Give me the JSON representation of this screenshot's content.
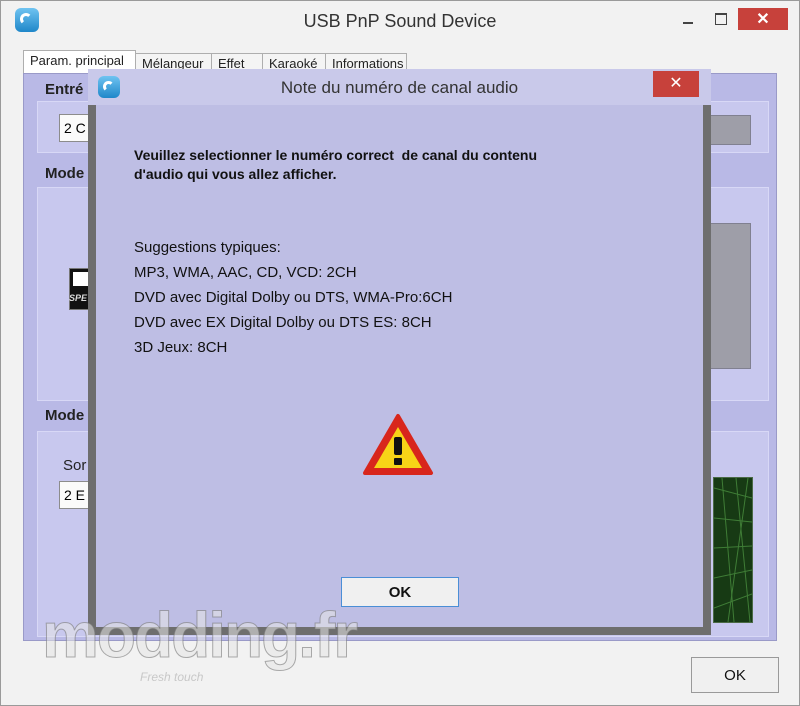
{
  "window": {
    "title": "USB PnP Sound Device",
    "close_glyph": "✕",
    "ok_label": "OK"
  },
  "tabs": [
    {
      "label": "Param. principal",
      "active": true
    },
    {
      "label": "Mélangeur",
      "active": false
    },
    {
      "label": "Effet",
      "active": false
    },
    {
      "label": "Karaoké",
      "active": false
    },
    {
      "label": "Informations",
      "active": false
    }
  ],
  "background": {
    "group1_label": "Entré",
    "group1_value": "2 C",
    "group2_label": "Mode",
    "group3_label": "Mode",
    "group3_sub_label": "Sor",
    "group3_value": "2 E"
  },
  "dialog": {
    "title": "Note du numéro de canal audio",
    "close_glyph": "✕",
    "message_line1": "Veuillez selectionner le numéro correct  de canal du contenu",
    "message_line2": "d'audio qui vous allez afficher.",
    "suggestions_title": "Suggestions typiques:",
    "suggestions": [
      "MP3, WMA, AAC, CD, VCD: 2CH",
      "DVD avec Digital Dolby ou DTS, WMA-Pro:6CH",
      "DVD avec EX Digital Dolby ou DTS ES: 8CH",
      "3D Jeux: 8CH"
    ],
    "ok_label": "OK"
  },
  "watermark": {
    "text": "modding.fr",
    "tagline": "Fresh touch"
  },
  "colors": {
    "dialog_bg": "#bebee4",
    "close_red": "#c7413b",
    "warning_yellow": "#f7d417"
  }
}
